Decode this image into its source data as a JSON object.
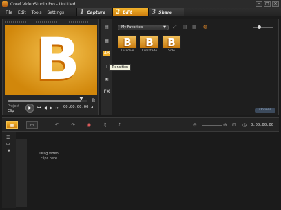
{
  "window": {
    "title": "Corel VideoStudio Pro - Untitled"
  },
  "menu": [
    "File",
    "Edit",
    "Tools",
    "Settings"
  ],
  "steps": [
    {
      "num": "1",
      "label": "Capture"
    },
    {
      "num": "2",
      "label": "Edit"
    },
    {
      "num": "3",
      "label": "Share"
    }
  ],
  "preview": {
    "letter": "B",
    "mode_project": "Project",
    "mode_clip": "Clip",
    "timecode": "00:00:00:00",
    "scrub_progress": 0.92
  },
  "library": {
    "dropdown_value": "My Favorites",
    "tiles": [
      {
        "letter": "B",
        "label": "Dissolve"
      },
      {
        "letter": "B",
        "label": "Crossfade"
      },
      {
        "letter": "B",
        "label": "Side"
      }
    ],
    "tooltip": "Transition",
    "fx_label": "FX",
    "options_label": "Options"
  },
  "timeline": {
    "timecode": "0:00:00:00",
    "drop_hint": "Drag video clips here"
  },
  "colors": {
    "accent": "#f0b02a",
    "preview_bg": "#e0a42e"
  }
}
